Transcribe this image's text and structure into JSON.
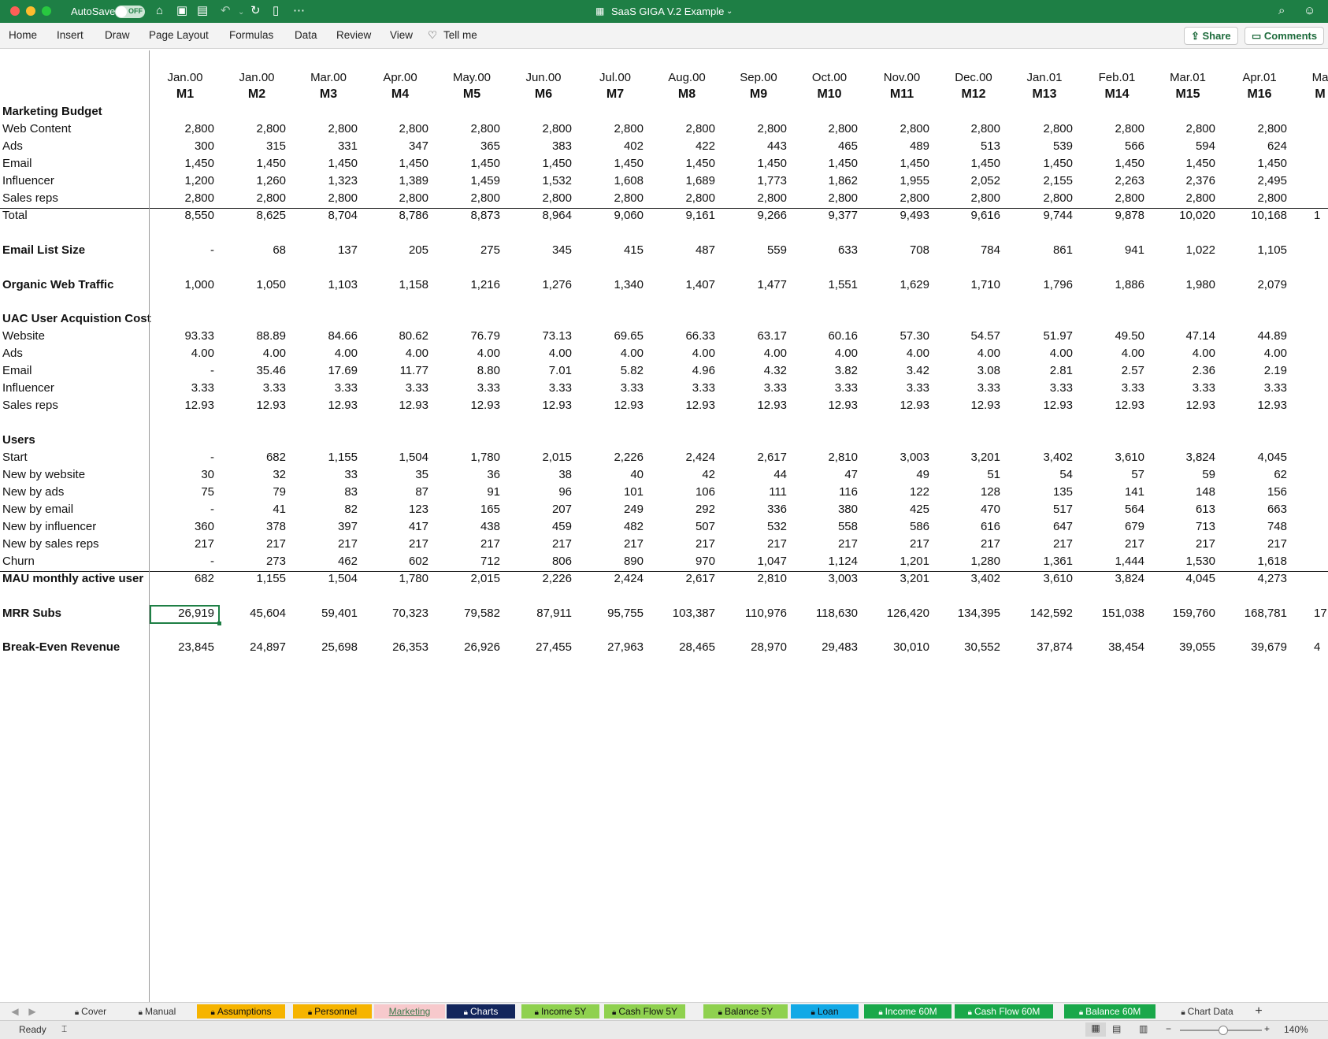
{
  "app": {
    "autosave_label": "AutoSave",
    "autosave_state": "OFF",
    "title": "SaaS GIGA V.2 Example",
    "accent_color": "#1e7f45"
  },
  "ribbon": {
    "tabs": [
      "Home",
      "Insert",
      "Draw",
      "Page Layout",
      "Formulas",
      "Data",
      "Review",
      "View"
    ],
    "tell_me": "Tell me",
    "share": "Share",
    "comments": "Comments"
  },
  "columns": {
    "months": [
      "Jan.00",
      "Jan.00",
      "Mar.00",
      "Apr.00",
      "May.00",
      "Jun.00",
      "Jul.00",
      "Aug.00",
      "Sep.00",
      "Oct.00",
      "Nov.00",
      "Dec.00",
      "Jan.01",
      "Feb.01",
      "Mar.01",
      "Apr.01",
      "Ma"
    ],
    "periods": [
      "M1",
      "M2",
      "M3",
      "M4",
      "M5",
      "M6",
      "M7",
      "M8",
      "M9",
      "M10",
      "M11",
      "M12",
      "M13",
      "M14",
      "M15",
      "M16",
      "M"
    ]
  },
  "rows": [
    {
      "label": "Marketing Budget",
      "bold": true,
      "values": []
    },
    {
      "label": "Web Content",
      "values": [
        "2,800",
        "2,800",
        "2,800",
        "2,800",
        "2,800",
        "2,800",
        "2,800",
        "2,800",
        "2,800",
        "2,800",
        "2,800",
        "2,800",
        "2,800",
        "2,800",
        "2,800",
        "2,800"
      ]
    },
    {
      "label": "Ads",
      "values": [
        "300",
        "315",
        "331",
        "347",
        "365",
        "383",
        "402",
        "422",
        "443",
        "465",
        "489",
        "513",
        "539",
        "566",
        "594",
        "624"
      ]
    },
    {
      "label": "Email",
      "values": [
        "1,450",
        "1,450",
        "1,450",
        "1,450",
        "1,450",
        "1,450",
        "1,450",
        "1,450",
        "1,450",
        "1,450",
        "1,450",
        "1,450",
        "1,450",
        "1,450",
        "1,450",
        "1,450"
      ]
    },
    {
      "label": "Influencer",
      "values": [
        "1,200",
        "1,260",
        "1,323",
        "1,389",
        "1,459",
        "1,532",
        "1,608",
        "1,689",
        "1,773",
        "1,862",
        "1,955",
        "2,052",
        "2,155",
        "2,263",
        "2,376",
        "2,495"
      ]
    },
    {
      "label": "Sales reps",
      "values": [
        "2,800",
        "2,800",
        "2,800",
        "2,800",
        "2,800",
        "2,800",
        "2,800",
        "2,800",
        "2,800",
        "2,800",
        "2,800",
        "2,800",
        "2,800",
        "2,800",
        "2,800",
        "2,800"
      ]
    },
    {
      "label": "Total",
      "values": [
        "8,550",
        "8,625",
        "8,704",
        "8,786",
        "8,873",
        "8,964",
        "9,060",
        "9,161",
        "9,266",
        "9,377",
        "9,493",
        "9,616",
        "9,744",
        "9,878",
        "10,020",
        "10,168",
        "1"
      ]
    },
    {
      "label": "",
      "values": []
    },
    {
      "label": "Email List Size",
      "bold": true,
      "values": [
        "-",
        "68",
        "137",
        "205",
        "275",
        "345",
        "415",
        "487",
        "559",
        "633",
        "708",
        "784",
        "861",
        "941",
        "1,022",
        "1,105"
      ]
    },
    {
      "label": "",
      "values": []
    },
    {
      "label": "Organic Web Traffic",
      "bold": true,
      "values": [
        "1,000",
        "1,050",
        "1,103",
        "1,158",
        "1,216",
        "1,276",
        "1,340",
        "1,407",
        "1,477",
        "1,551",
        "1,629",
        "1,710",
        "1,796",
        "1,886",
        "1,980",
        "2,079"
      ]
    },
    {
      "label": "",
      "values": []
    },
    {
      "label": "UAC User Acquistion Cost",
      "bold": true,
      "values": []
    },
    {
      "label": "Website",
      "values": [
        "93.33",
        "88.89",
        "84.66",
        "80.62",
        "76.79",
        "73.13",
        "69.65",
        "66.33",
        "63.17",
        "60.16",
        "57.30",
        "54.57",
        "51.97",
        "49.50",
        "47.14",
        "44.89"
      ]
    },
    {
      "label": "Ads",
      "values": [
        "4.00",
        "4.00",
        "4.00",
        "4.00",
        "4.00",
        "4.00",
        "4.00",
        "4.00",
        "4.00",
        "4.00",
        "4.00",
        "4.00",
        "4.00",
        "4.00",
        "4.00",
        "4.00"
      ]
    },
    {
      "label": "Email",
      "values": [
        "-",
        "35.46",
        "17.69",
        "11.77",
        "8.80",
        "7.01",
        "5.82",
        "4.96",
        "4.32",
        "3.82",
        "3.42",
        "3.08",
        "2.81",
        "2.57",
        "2.36",
        "2.19"
      ]
    },
    {
      "label": "Influencer",
      "values": [
        "3.33",
        "3.33",
        "3.33",
        "3.33",
        "3.33",
        "3.33",
        "3.33",
        "3.33",
        "3.33",
        "3.33",
        "3.33",
        "3.33",
        "3.33",
        "3.33",
        "3.33",
        "3.33"
      ]
    },
    {
      "label": "Sales reps",
      "values": [
        "12.93",
        "12.93",
        "12.93",
        "12.93",
        "12.93",
        "12.93",
        "12.93",
        "12.93",
        "12.93",
        "12.93",
        "12.93",
        "12.93",
        "12.93",
        "12.93",
        "12.93",
        "12.93"
      ]
    },
    {
      "label": "",
      "values": []
    },
    {
      "label": "Users",
      "bold": true,
      "values": []
    },
    {
      "label": "Start",
      "values": [
        "-",
        "682",
        "1,155",
        "1,504",
        "1,780",
        "2,015",
        "2,226",
        "2,424",
        "2,617",
        "2,810",
        "3,003",
        "3,201",
        "3,402",
        "3,610",
        "3,824",
        "4,045"
      ]
    },
    {
      "label": "New by website",
      "values": [
        "30",
        "32",
        "33",
        "35",
        "36",
        "38",
        "40",
        "42",
        "44",
        "47",
        "49",
        "51",
        "54",
        "57",
        "59",
        "62"
      ]
    },
    {
      "label": "New by ads",
      "values": [
        "75",
        "79",
        "83",
        "87",
        "91",
        "96",
        "101",
        "106",
        "111",
        "116",
        "122",
        "128",
        "135",
        "141",
        "148",
        "156"
      ]
    },
    {
      "label": "New by email",
      "values": [
        "-",
        "41",
        "82",
        "123",
        "165",
        "207",
        "249",
        "292",
        "336",
        "380",
        "425",
        "470",
        "517",
        "564",
        "613",
        "663"
      ]
    },
    {
      "label": "New by influencer",
      "values": [
        "360",
        "378",
        "397",
        "417",
        "438",
        "459",
        "482",
        "507",
        "532",
        "558",
        "586",
        "616",
        "647",
        "679",
        "713",
        "748"
      ]
    },
    {
      "label": "New by sales reps",
      "values": [
        "217",
        "217",
        "217",
        "217",
        "217",
        "217",
        "217",
        "217",
        "217",
        "217",
        "217",
        "217",
        "217",
        "217",
        "217",
        "217"
      ]
    },
    {
      "label": "Churn",
      "values": [
        "-",
        "273",
        "462",
        "602",
        "712",
        "806",
        "890",
        "970",
        "1,047",
        "1,124",
        "1,201",
        "1,280",
        "1,361",
        "1,444",
        "1,530",
        "1,618"
      ]
    },
    {
      "label": "MAU monthly active user",
      "bold": true,
      "values": [
        "682",
        "1,155",
        "1,504",
        "1,780",
        "2,015",
        "2,226",
        "2,424",
        "2,617",
        "2,810",
        "3,003",
        "3,201",
        "3,402",
        "3,610",
        "3,824",
        "4,045",
        "4,273"
      ]
    },
    {
      "label": "",
      "values": []
    },
    {
      "label": "MRR  Subs",
      "bold": true,
      "values": [
        "26,919",
        "45,604",
        "59,401",
        "70,323",
        "79,582",
        "87,911",
        "95,755",
        "103,387",
        "110,976",
        "118,630",
        "126,420",
        "134,395",
        "142,592",
        "151,038",
        "159,760",
        "168,781",
        "17"
      ]
    },
    {
      "label": "",
      "values": []
    },
    {
      "label": "Break-Even Revenue",
      "bold": true,
      "values": [
        "23,845",
        "24,897",
        "25,698",
        "26,353",
        "26,926",
        "27,455",
        "27,963",
        "28,465",
        "28,970",
        "29,483",
        "30,010",
        "30,552",
        "37,874",
        "38,454",
        "39,055",
        "39,679",
        "4"
      ]
    }
  ],
  "sheet_tabs": [
    {
      "name": "Cover",
      "bg": "#f0f0f0",
      "fg": "#333333",
      "lock": true
    },
    {
      "name": "Manual",
      "bg": "#f0f0f0",
      "fg": "#333333",
      "lock": true
    },
    {
      "name": "Assumptions",
      "bg": "#f6b400",
      "fg": "#111111",
      "lock": true
    },
    {
      "name": "Personnel",
      "bg": "#f6b400",
      "fg": "#111111",
      "lock": true
    },
    {
      "name": "Marketing",
      "bg": "#f7c9cc",
      "fg": "#3c7a4c",
      "lock": false,
      "active": true
    },
    {
      "name": "Charts",
      "bg": "#13265c",
      "fg": "#ffffff",
      "lock": true
    },
    {
      "name": "Income 5Y",
      "bg": "#8fd14f",
      "fg": "#111111",
      "lock": true
    },
    {
      "name": "Cash Flow 5Y",
      "bg": "#8fd14f",
      "fg": "#111111",
      "lock": true
    },
    {
      "name": "Balance 5Y",
      "bg": "#8fd14f",
      "fg": "#111111",
      "lock": true
    },
    {
      "name": "Loan",
      "bg": "#12a9e6",
      "fg": "#111111",
      "lock": true
    },
    {
      "name": "Income 60M",
      "bg": "#1aa84a",
      "fg": "#ffffff",
      "lock": true
    },
    {
      "name": "Cash Flow 60M",
      "bg": "#1aa84a",
      "fg": "#ffffff",
      "lock": true
    },
    {
      "name": "Balance 60M",
      "bg": "#1aa84a",
      "fg": "#ffffff",
      "lock": true
    },
    {
      "name": "Chart Data",
      "bg": "#f0f0f0",
      "fg": "#333333",
      "lock": true
    }
  ],
  "status": {
    "ready": "Ready",
    "zoom": "140%"
  }
}
